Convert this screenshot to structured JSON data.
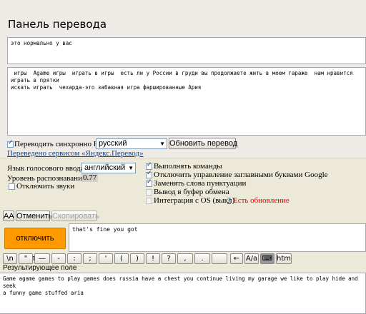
{
  "title": "Панель перевода",
  "source_text": "это нормально у вас",
  "translation_text": " игры  Agame игры  играть в игры  есть ли у России в груди вы продолжаете жить в моем гараже  нам нравится играть в прятки  \nискать играть  чехарда-это забавная игра фаршированные Ария",
  "sync": {
    "label": "Переводить синхронно На",
    "target_language": "русский",
    "update_button": "Обновить перевод"
  },
  "service_link": "Переведено сервисом «Яндекс.Перевод»",
  "voice": {
    "language_label": "Язык голосового ввода",
    "language_value": "английский",
    "recognition_label": "Уровень распознавания",
    "recognition_value": "0.77",
    "mute_label": "Отключить звуки"
  },
  "options": [
    {
      "label": "Выполнять команды",
      "checked": true,
      "enabled": true
    },
    {
      "label": "Отключить управление заглавными буквами Google",
      "checked": true,
      "enabled": true
    },
    {
      "label": "Заменять слова пунктуации",
      "checked": true,
      "enabled": true
    },
    {
      "label": "Вывод в буфер обмена",
      "checked": false,
      "enabled": false
    },
    {
      "label": "Интеграция с OS (выкл)",
      "checked": false,
      "enabled": false
    }
  ],
  "integration_help": "?",
  "update_available": "Есть обновление",
  "toolbar": {
    "aa": "AA",
    "cancel": "Отменить",
    "copy": "Скопировать"
  },
  "record_button": "отключить запись",
  "voice_text": "that's fine you got",
  "keys": [
    "\\n",
    "\"",
    "—",
    "-",
    ":",
    ";",
    "'",
    "(",
    ")",
    "!",
    "?",
    ",",
    ".",
    "",
    "←",
    "A/a",
    "⌨",
    "htm"
  ],
  "result_label": "Результирующее поле",
  "result_text": "Game agame games to play games does russia have a chest you continue living my garage we like to play hide and seek \na funny game stuffed aria",
  "colors": {
    "record_button": "#ff9900",
    "update_link": "#dd0000",
    "link": "#0645ad"
  }
}
